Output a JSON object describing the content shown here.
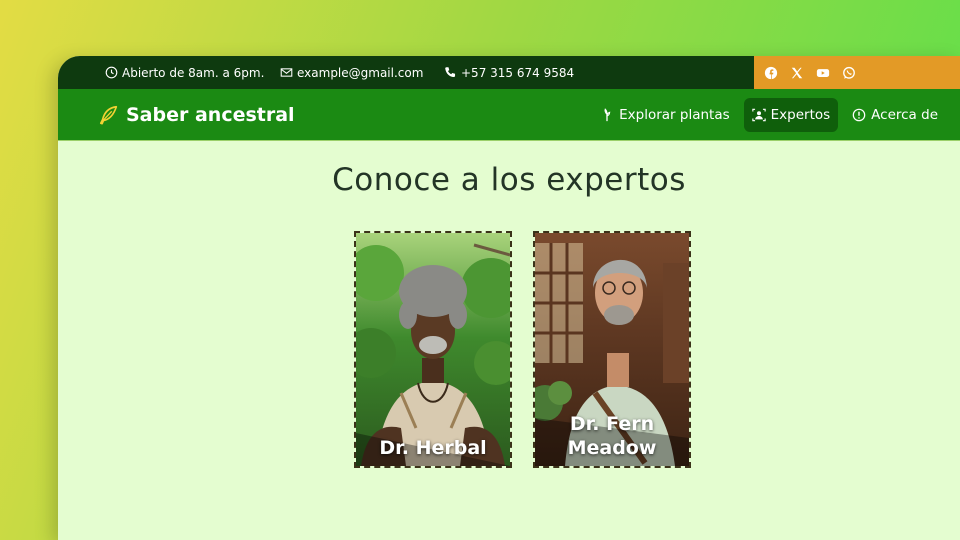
{
  "topbar": {
    "hours": "Abierto de 8am. a 6pm.",
    "email": "example@gmail.com",
    "phone": "+57 315 674 9584",
    "social_icons": [
      "facebook-icon",
      "x-icon",
      "youtube-icon",
      "whatsapp-icon"
    ]
  },
  "nav": {
    "brand": "Saber ancestral",
    "links": [
      {
        "label": "Explorar plantas",
        "icon": "seedling-icon"
      },
      {
        "label": "Expertos",
        "icon": "experts-icon",
        "active": true
      },
      {
        "label": "Acerca de",
        "icon": "info-icon"
      }
    ]
  },
  "main": {
    "title": "Conoce a los expertos",
    "experts": [
      {
        "name": "Dr. Herbal"
      },
      {
        "name": "Dr. Fern Meadow"
      }
    ]
  },
  "colors": {
    "topbar_bg": "#0e3a0f",
    "social_bg": "#e39a26",
    "navbar_bg": "#1b8a13",
    "nav_active_bg": "#0f5f0b",
    "page_bg": "#e4fdd0"
  }
}
